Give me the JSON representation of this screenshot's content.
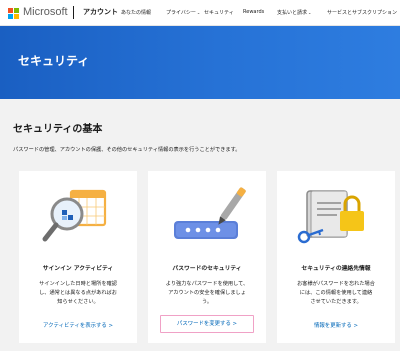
{
  "header": {
    "logo": "Microsoft",
    "section": "アカウント",
    "nav": [
      {
        "label": "あなたの情報",
        "has_dropdown": false
      },
      {
        "label": "プライバシー",
        "has_dropdown": true
      },
      {
        "label": "セキュリティ",
        "has_dropdown": false
      },
      {
        "label": "Rewards",
        "has_dropdown": false
      },
      {
        "label": "支払いと請求",
        "has_dropdown": true
      },
      {
        "label": "サービスとサブスクリプション",
        "has_dropdown": false
      }
    ]
  },
  "hero": {
    "title": "セキュリティ"
  },
  "section": {
    "title": "セキュリティの基本",
    "description": "パスワードの管理、アカウントの保護、その他のセキュリティ情報の表示を行うことができます。"
  },
  "cards": [
    {
      "title": "サインイン アクティビティ",
      "body": [
        "サインインした日時と場所を確認",
        "し、通常とは異なる点があればお",
        "知らせください。"
      ],
      "link": "アクティビティを表示する >",
      "icon": "magnifier-calendar-icon"
    },
    {
      "title": "パスワードのセキュリティ",
      "body": [
        "より強力なパスワードを使用して、",
        "アカウントの安全を確保しましょ",
        "う。"
      ],
      "link": "パスワードを変更する >",
      "icon": "password-pen-icon"
    },
    {
      "title": "セキュリティの連絡先情報",
      "body": [
        "お客様がパスワードを忘れた場合",
        "には、この情報を使用して連絡",
        "させていただきます。"
      ],
      "link": "情報を更新する >",
      "icon": "contact-lock-icon"
    }
  ],
  "colors": {
    "hero": "#1a5fc2",
    "link": "#0067b8",
    "highlight_border": "#f0a1c6",
    "logo": [
      "#f25022",
      "#7fba00",
      "#00a4ef",
      "#ffb900"
    ]
  }
}
